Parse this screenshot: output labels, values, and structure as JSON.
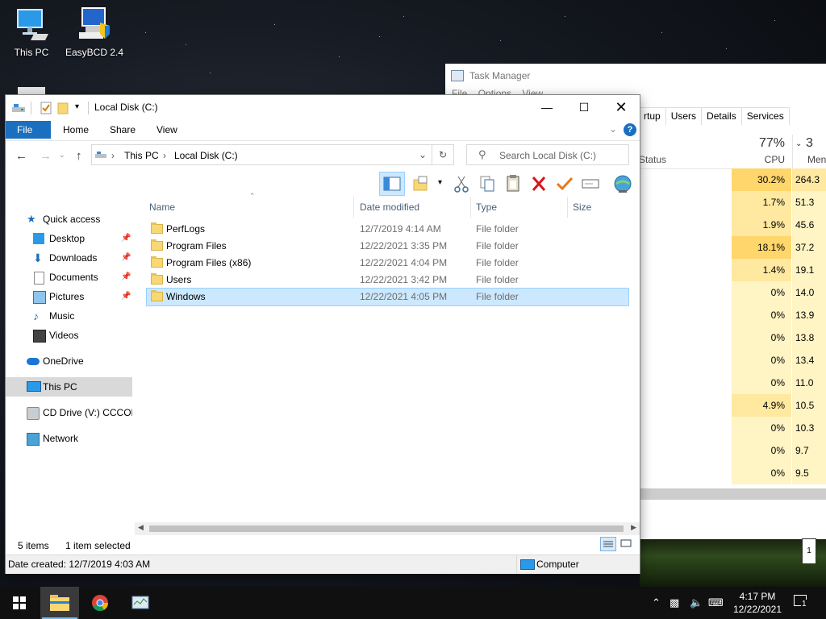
{
  "desktop": {
    "icons": [
      {
        "label": "This PC"
      },
      {
        "label": "EasyBCD 2.4"
      }
    ]
  },
  "task_manager": {
    "title": "Task Manager",
    "menu": [
      "File",
      "Options",
      "View"
    ],
    "tabs": [
      "rtup",
      "Users",
      "Details",
      "Services"
    ],
    "status_header": "Status",
    "cpu_percent": "77%",
    "cpu_label": "CPU",
    "mem_percent": "3",
    "mem_label": "Men",
    "rows": [
      {
        "cpu": "30.2%",
        "mem": "264.3"
      },
      {
        "cpu": "1.7%",
        "mem": "51.3"
      },
      {
        "cpu": "1.9%",
        "mem": "45.6"
      },
      {
        "cpu": "18.1%",
        "mem": "37.2"
      },
      {
        "cpu": "1.4%",
        "mem": "19.1"
      },
      {
        "cpu": "0%",
        "mem": "14.0"
      },
      {
        "cpu": "0%",
        "mem": "13.9"
      },
      {
        "cpu": "0%",
        "mem": "13.8"
      },
      {
        "cpu": "0%",
        "mem": "13.4"
      },
      {
        "cpu": "0%",
        "mem": "11.0"
      },
      {
        "cpu": "4.9%",
        "mem": "10.5"
      },
      {
        "cpu": "0%",
        "mem": "10.3"
      },
      {
        "cpu": "0%",
        "mem": "9.7"
      },
      {
        "cpu": "0%",
        "mem": "9.5"
      }
    ],
    "notification_badge": "1"
  },
  "explorer": {
    "title": "Local Disk (C:)",
    "ribbon_tabs": {
      "file": "File",
      "home": "Home",
      "share": "Share",
      "view": "View"
    },
    "help": "?",
    "address": {
      "root": "This PC",
      "current": "Local Disk (C:)"
    },
    "search_placeholder": "Search Local Disk (C:)",
    "nav": {
      "quick_access": "Quick access",
      "desktop": "Desktop",
      "downloads": "Downloads",
      "documents": "Documents",
      "pictures": "Pictures",
      "music": "Music",
      "videos": "Videos",
      "onedrive": "OneDrive",
      "this_pc": "This PC",
      "cd_drive": "CD Drive (V:) CCCOM",
      "network": "Network"
    },
    "columns": {
      "name": "Name",
      "date": "Date modified",
      "type": "Type",
      "size": "Size"
    },
    "files": [
      {
        "name": "PerfLogs",
        "date": "12/7/2019 4:14 AM",
        "type": "File folder"
      },
      {
        "name": "Program Files",
        "date": "12/22/2021 3:35 PM",
        "type": "File folder"
      },
      {
        "name": "Program Files (x86)",
        "date": "12/22/2021 4:04 PM",
        "type": "File folder"
      },
      {
        "name": "Users",
        "date": "12/22/2021 3:42 PM",
        "type": "File folder"
      },
      {
        "name": "Windows",
        "date": "12/22/2021 4:05 PM",
        "type": "File folder",
        "selected": true
      }
    ],
    "status": {
      "count": "5 items",
      "selected": "1 item selected"
    },
    "details": {
      "created": "Date created: 12/7/2019 4:03 AM",
      "location": "Computer"
    }
  },
  "taskbar": {
    "time": "4:17 PM",
    "date": "12/22/2021",
    "notifications": "1"
  },
  "colors": {
    "accent": "#1a6fbf",
    "selection": "#cce8ff",
    "cpu_high": "#ffd66b",
    "cpu_mid": "#ffe9a0",
    "cpu_low": "#fff4c4"
  }
}
